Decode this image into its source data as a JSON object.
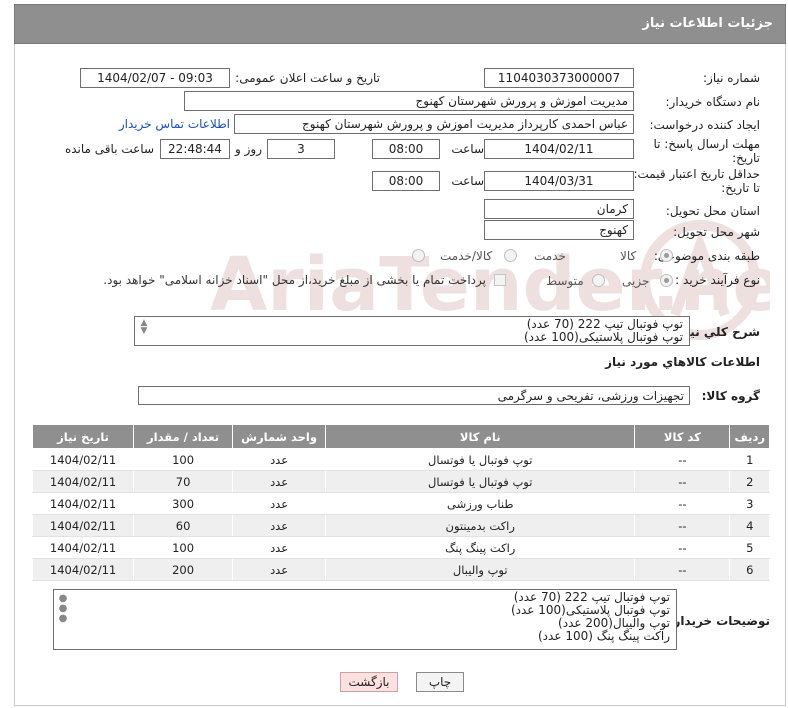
{
  "header": {
    "title": "جزئیات اطلاعات نیاز"
  },
  "watermark": {
    "text": "AriaTender.neT"
  },
  "fields": {
    "need_number": {
      "label": "شماره نیاز:",
      "value": "1104030373000007"
    },
    "announce_datetime": {
      "label": "تاریخ و ساعت اعلان عمومی:",
      "value": "1404/02/07 - 09:03"
    },
    "buyer_org": {
      "label": "نام دستگاه خریدار:",
      "value": "مدیریت اموزش و پرورش شهرستان کهنوج"
    },
    "requester": {
      "label": "ایجاد کننده درخواست:",
      "value": "عباس احمدی کارپرداز مدیریت اموزش و پرورش شهرستان کهنوج",
      "contact_link": "اطلاعات تماس خریدار"
    },
    "reply_deadline": {
      "label_line1": "مهلت ارسال پاسخ: تا",
      "label_line2": "تاریخ:",
      "date": "1404/02/11",
      "time_label": "ساعت",
      "time": "08:00",
      "days": "3",
      "days_label": "روز و",
      "remaining": "22:48:44",
      "remaining_label": "ساعت باقی مانده"
    },
    "price_validity": {
      "label_line1": "حداقل تاریخ اعتبار قیمت:",
      "label_line2": "تا تاریخ:",
      "date": "1404/03/31",
      "time_label": "ساعت",
      "time": "08:00"
    },
    "delivery_province": {
      "label": "استان محل تحویل:",
      "value": "کرمان"
    },
    "delivery_city": {
      "label": "شهر محل تحویل:",
      "value": "کهنوج"
    },
    "category": {
      "label": "طبقه بندی موضوعی:",
      "options": [
        "کالا",
        "خدمت",
        "کالا/خدمت"
      ],
      "selected": "کالا"
    },
    "purchase_process": {
      "label": "نوع فرآیند خرید :",
      "options": [
        "جزیی",
        "متوسط"
      ],
      "selected": "جزیی",
      "note": "پرداخت تمام یا بخشی از مبلغ خرید،از محل \"اسناد خزانه اسلامی\" خواهد بود."
    }
  },
  "summary": {
    "label": "شرح كلي نياز:",
    "lines": [
      "توپ فوتبال تیپ 222    (70 عدد)",
      "توپ فوتبال پلاستیکی(100 عدد)"
    ]
  },
  "goods_section": {
    "title": "اطلاعات كالاهاي مورد نياز",
    "group_label": "گروه کالا:",
    "group_value": "تجهیزات ورزشی، تفریحی و سرگرمی"
  },
  "table": {
    "columns": [
      "ردیف",
      "کد کالا",
      "نام کالا",
      "واحد شمارش",
      "تعداد / مقدار",
      "تاریخ نیاز"
    ],
    "rows": [
      [
        "1",
        "--",
        "توپ فوتبال یا فوتسال",
        "عدد",
        "100",
        "1404/02/11"
      ],
      [
        "2",
        "--",
        "توپ فوتبال یا فوتسال",
        "عدد",
        "70",
        "1404/02/11"
      ],
      [
        "3",
        "--",
        "طناب ورزشی",
        "عدد",
        "300",
        "1404/02/11"
      ],
      [
        "4",
        "--",
        "راکت بدمینتون",
        "عدد",
        "60",
        "1404/02/11"
      ],
      [
        "5",
        "--",
        "راکت پینگ پنگ",
        "عدد",
        "100",
        "1404/02/11"
      ],
      [
        "6",
        "--",
        "توپ والیبال",
        "عدد",
        "200",
        "1404/02/11"
      ]
    ]
  },
  "buyer_notes": {
    "label": "توضیحات خریدار:",
    "lines": [
      "توپ فوتبال تیپ 222    (70 عدد)",
      "توپ فوتبال پلاستیکی(100 عدد)",
      "توپ والیبال(200 عدد)",
      "راکت پینگ پنگ (100 عدد)"
    ]
  },
  "buttons": {
    "print": "چاپ",
    "back": "بازگشت"
  }
}
